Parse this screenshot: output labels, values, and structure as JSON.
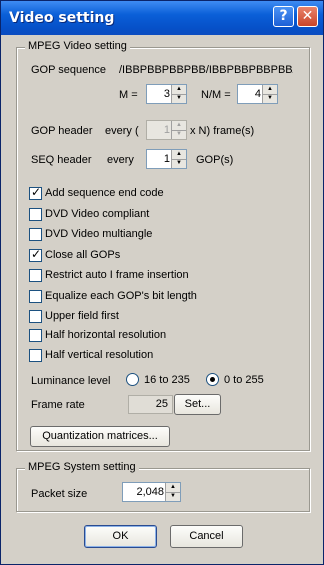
{
  "window": {
    "title": "Video setting",
    "help_label": "?",
    "close_label": "✕"
  },
  "mpeg_video": {
    "legend": "MPEG Video setting",
    "gop_sequence_label": "GOP sequence",
    "gop_sequence_value": "/IBBPBBPBBPBB/IBBPBBPBBPBB/",
    "m_label": "M =",
    "m_value": "3",
    "nm_label": "N/M =",
    "nm_value": "4",
    "gop_header_label": "GOP header",
    "gop_header_every": "every (",
    "gop_header_value": "1",
    "gop_header_suffix": "x N) frame(s)",
    "seq_header_label": "SEQ header",
    "seq_header_every": "every",
    "seq_header_value": "1",
    "seq_header_suffix": "GOP(s)",
    "checkboxes": [
      {
        "label": "Add sequence end code",
        "checked": true
      },
      {
        "label": "DVD Video compliant",
        "checked": false
      },
      {
        "label": "DVD Video multiangle",
        "checked": false
      },
      {
        "label": "Close all GOPs",
        "checked": true
      },
      {
        "label": "Restrict auto I frame insertion",
        "checked": false
      },
      {
        "label": "Equalize each GOP's bit length",
        "checked": false
      },
      {
        "label": "Upper field first",
        "checked": false
      },
      {
        "label": "Half horizontal resolution",
        "checked": false
      },
      {
        "label": "Half vertical resolution",
        "checked": false
      }
    ],
    "luminance_label": "Luminance level",
    "luminance_options": [
      "16 to 235",
      "0 to 255"
    ],
    "luminance_selected": "0 to 255",
    "frame_rate_label": "Frame rate",
    "frame_rate_value": "25",
    "frame_rate_set_label": "Set...",
    "quantization_label": "Quantization matrices..."
  },
  "mpeg_system": {
    "legend": "MPEG System setting",
    "packet_size_label": "Packet size",
    "packet_size_value": "2,048"
  },
  "buttons": {
    "ok": "OK",
    "cancel": "Cancel"
  },
  "colors": {
    "titlebar": "#0a5fd8",
    "dialog_bg": "#d4d0c8"
  }
}
